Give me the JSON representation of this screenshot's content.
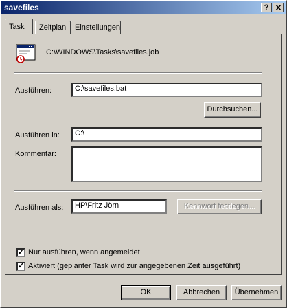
{
  "window": {
    "title": "savefiles",
    "help_button": "?",
    "close_button": "X"
  },
  "tabs": [
    {
      "label": "Task",
      "active": true
    },
    {
      "label": "Zeitplan",
      "active": false
    },
    {
      "label": "Einstellungen",
      "active": false
    }
  ],
  "task": {
    "job_path": "C:\\WINDOWS\\Tasks\\savefiles.job",
    "run_label": "Ausführen:",
    "run_value": "C:\\savefiles.bat",
    "browse_button": "Durchsuchen...",
    "start_in_label": "Ausführen in:",
    "start_in_value": "C:\\",
    "comment_label": "Kommentar:",
    "comment_value": "",
    "run_as_label": "Ausführen als:",
    "run_as_value": "HP\\Fritz Jörn",
    "set_password_button": "Kennwort festlegen...",
    "only_logged_on_label": "Nur ausführen, wenn angemeldet",
    "only_logged_on_checked": true,
    "enabled_label": "Aktiviert (geplanter Task wird zur angegebenen Zeit ausgeführt)",
    "enabled_checked": true
  },
  "buttons": {
    "ok": "OK",
    "cancel": "Abbrechen",
    "apply": "Übernehmen"
  },
  "icons": {
    "task_icon": "scheduled-task-icon",
    "check": "✓"
  }
}
